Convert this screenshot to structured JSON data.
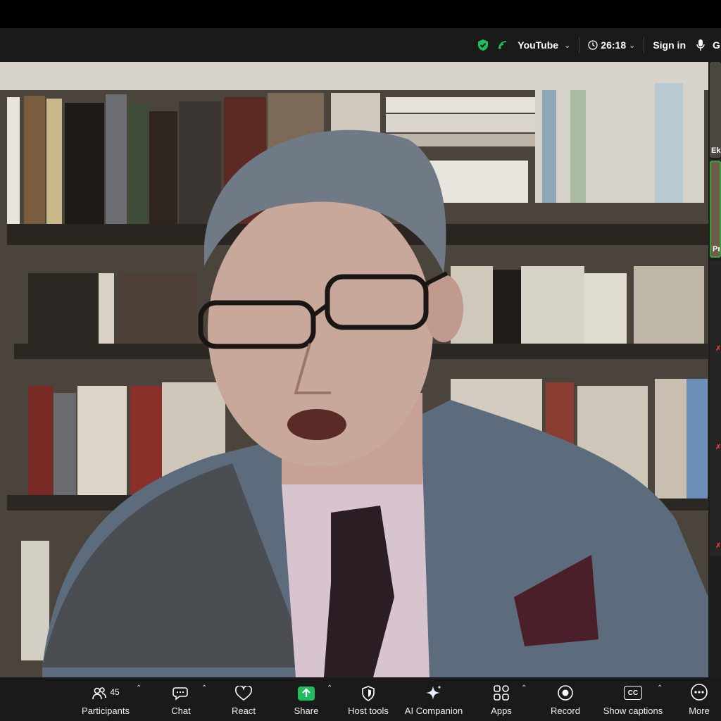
{
  "topbar": {
    "stream_label": "YouTube",
    "elapsed": "26:18",
    "signin_label": "Sign in",
    "cutoff_text": "G"
  },
  "thumbnails": [
    {
      "label": "Ek"
    },
    {
      "label": "Pr"
    }
  ],
  "toolbar": {
    "participants_count": "45",
    "items": [
      {
        "label": "Participants",
        "icon": "participants-icon"
      },
      {
        "label": "Chat",
        "icon": "chat-icon"
      },
      {
        "label": "React",
        "icon": "heart-icon"
      },
      {
        "label": "Share",
        "icon": "share-arrow-icon"
      },
      {
        "label": "Host tools",
        "icon": "shield-icon"
      },
      {
        "label": "AI Companion",
        "icon": "sparkle-icon"
      },
      {
        "label": "Apps",
        "icon": "apps-icon"
      },
      {
        "label": "Record",
        "icon": "record-icon"
      },
      {
        "label": "Show captions",
        "icon": "cc-icon"
      },
      {
        "label": "More",
        "icon": "more-dots-icon"
      }
    ],
    "cc_text": "CC"
  },
  "colors": {
    "toolbar_bg": "#1a1a1a",
    "share_green": "#1fbd5b",
    "shield_green": "#1fbd5b",
    "active_speaker_border": "#3c9e3c"
  }
}
